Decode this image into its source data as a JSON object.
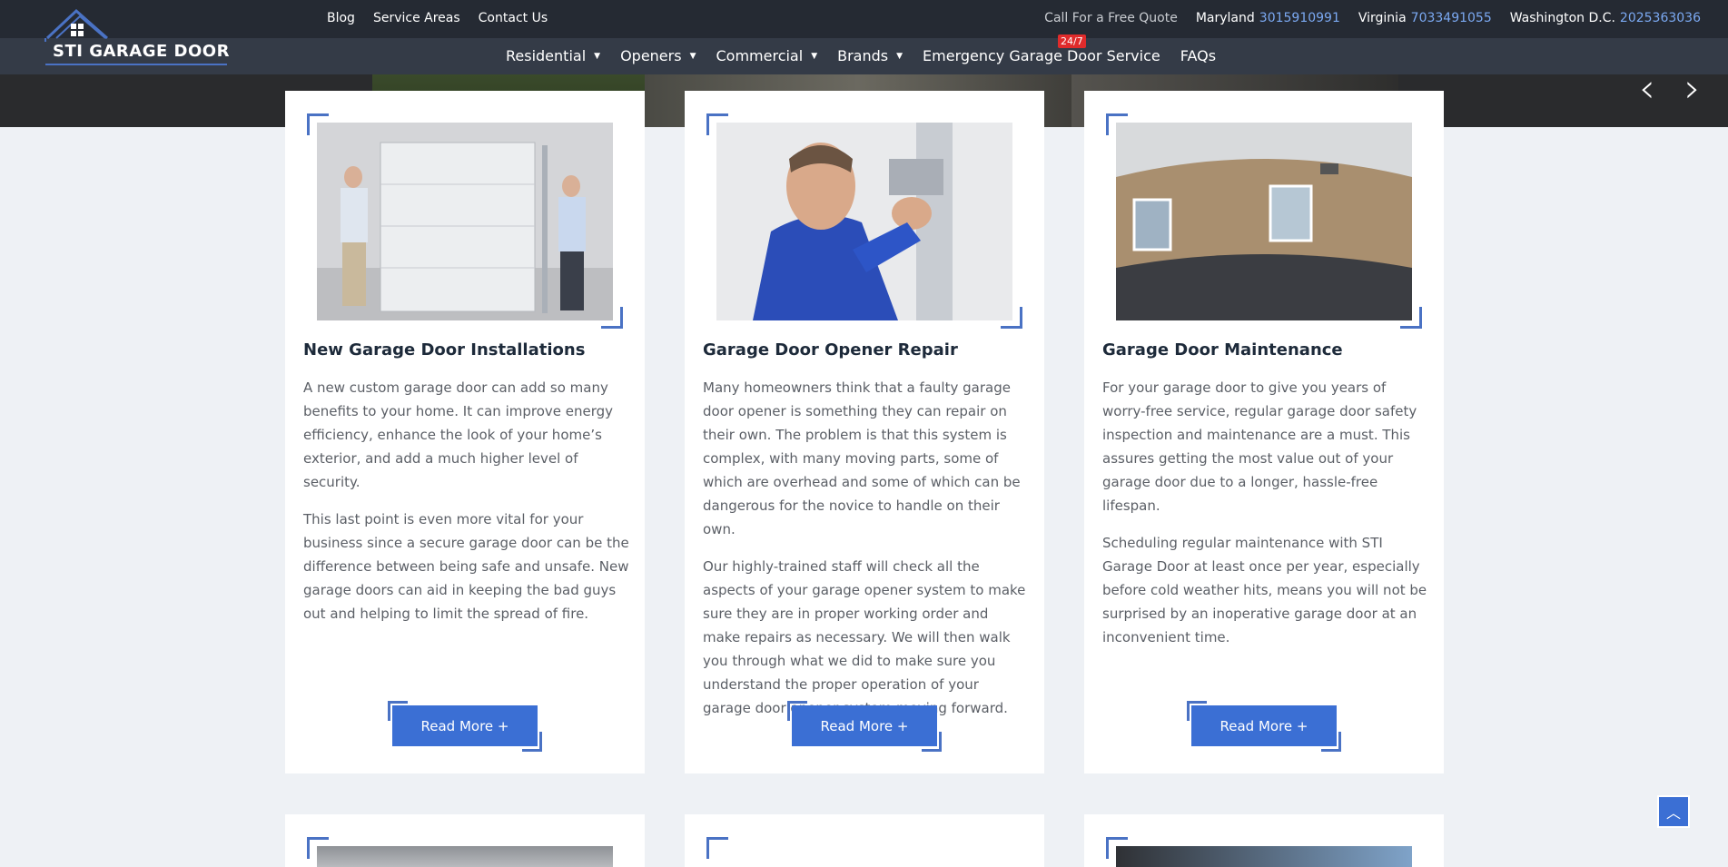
{
  "brand": {
    "name": "STI GARAGE DOOR"
  },
  "toplinks": [
    "Blog",
    "Service Areas",
    "Contact Us"
  ],
  "call": {
    "label": "Call For a Free Quote",
    "regions": [
      {
        "name": "Maryland",
        "phone": "3015910991"
      },
      {
        "name": "Virginia",
        "phone": "7033491055"
      },
      {
        "name": "Washington D.C.",
        "phone": "2025363036"
      }
    ]
  },
  "nav": [
    {
      "label": "Residential",
      "dropdown": true
    },
    {
      "label": "Openers",
      "dropdown": true
    },
    {
      "label": "Commercial",
      "dropdown": true
    },
    {
      "label": "Brands",
      "dropdown": true
    },
    {
      "label": "Emergency Garage Door Service",
      "dropdown": false
    },
    {
      "label": "FAQs",
      "dropdown": false
    }
  ],
  "badge": "24/7",
  "cards": [
    {
      "title": "New Garage Door Installations",
      "paragraphs": [
        "A new custom garage door can add so many benefits to your home. It can improve energy efficiency, enhance the look of your home’s exterior, and add a much higher level of security.",
        "This last point is even more vital for your business since a secure garage door can be the difference between being safe and unsafe. New garage doors can aid in keeping the bad guys out and helping to limit the spread of fire."
      ],
      "button": "Read More +"
    },
    {
      "title": "Garage Door Opener Repair",
      "paragraphs": [
        "Many homeowners think that a faulty garage door opener is something they can repair on their own. The problem is that this system is complex, with many moving parts, some of which are overhead and some of which can be dangerous for the novice to handle on their own.",
        "Our highly-trained staff will check all the aspects of your garage opener system to make sure they are in proper working order and make repairs as necessary. We will then walk you through what we did to make sure you understand the proper operation of your garage door opener system moving forward."
      ],
      "button": "Read More +"
    },
    {
      "title": "Garage Door Maintenance",
      "paragraphs": [
        "For your garage door to give you years of worry-free service, regular garage door safety inspection and maintenance are a must. This assures getting the most value out of your garage door due to a longer, hassle-free lifespan.",
        "Scheduling regular maintenance with STI Garage Door at least once per year, especially before cold weather hits, means you will not be surprised by an inoperative garage door at an inconvenient time."
      ],
      "button": "Read More +"
    }
  ],
  "colors": {
    "accent": "#3b6fd4",
    "topbar": "#252a33",
    "navbar": "#343b47",
    "phone": "#7ba9f2"
  }
}
